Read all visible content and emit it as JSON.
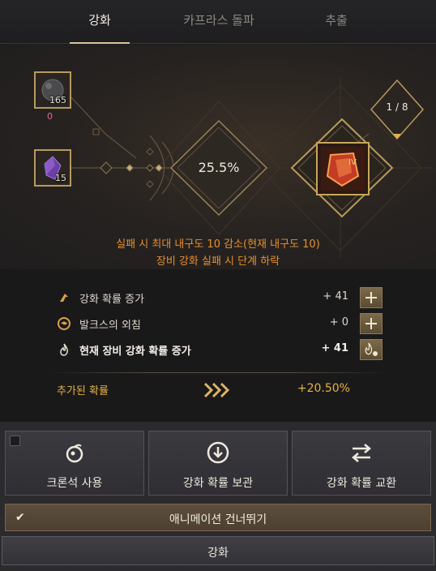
{
  "tabs": [
    {
      "label": "강화",
      "active": true
    },
    {
      "label": "카프라스 돌파",
      "active": false
    },
    {
      "label": "추출",
      "active": false
    }
  ],
  "materials": [
    {
      "icon": "stone-icon",
      "count": "165",
      "sub": "0"
    },
    {
      "icon": "crystal-icon",
      "count": "15"
    }
  ],
  "rate": "25.5%",
  "step_counter": "1 / 8",
  "warnings": {
    "line1": "실패 시 최대 내구도 10 감소(현재 내구도 10)",
    "line2": "장비 강화 실패 시 단계 하락"
  },
  "bonus_rows": [
    {
      "icon": "arrow-up-icon",
      "label": "강화 확률 증가",
      "value": "+ 41"
    },
    {
      "icon": "valks-icon",
      "label": "발크스의 외침",
      "value": "+ 0"
    },
    {
      "icon": "flame-icon",
      "label": "현재 장비 강화 확률 증가",
      "value": "+ 41"
    }
  ],
  "added": {
    "label": "추가된 확률",
    "value": "+20.50%"
  },
  "actions": [
    {
      "icon": "cron-stone-icon",
      "label": "크론석 사용"
    },
    {
      "icon": "download-icon",
      "label": "강화 확률 보관"
    },
    {
      "icon": "swap-icon",
      "label": "강화 확률 교환"
    }
  ],
  "skip_animation": {
    "label": "애니메이션 건너뛰기",
    "checked": true
  },
  "enhance_button": "강화",
  "colors": {
    "accent_gold": "#b69a5e",
    "warning": "#e7902f",
    "bonus": "#e3b24a"
  }
}
